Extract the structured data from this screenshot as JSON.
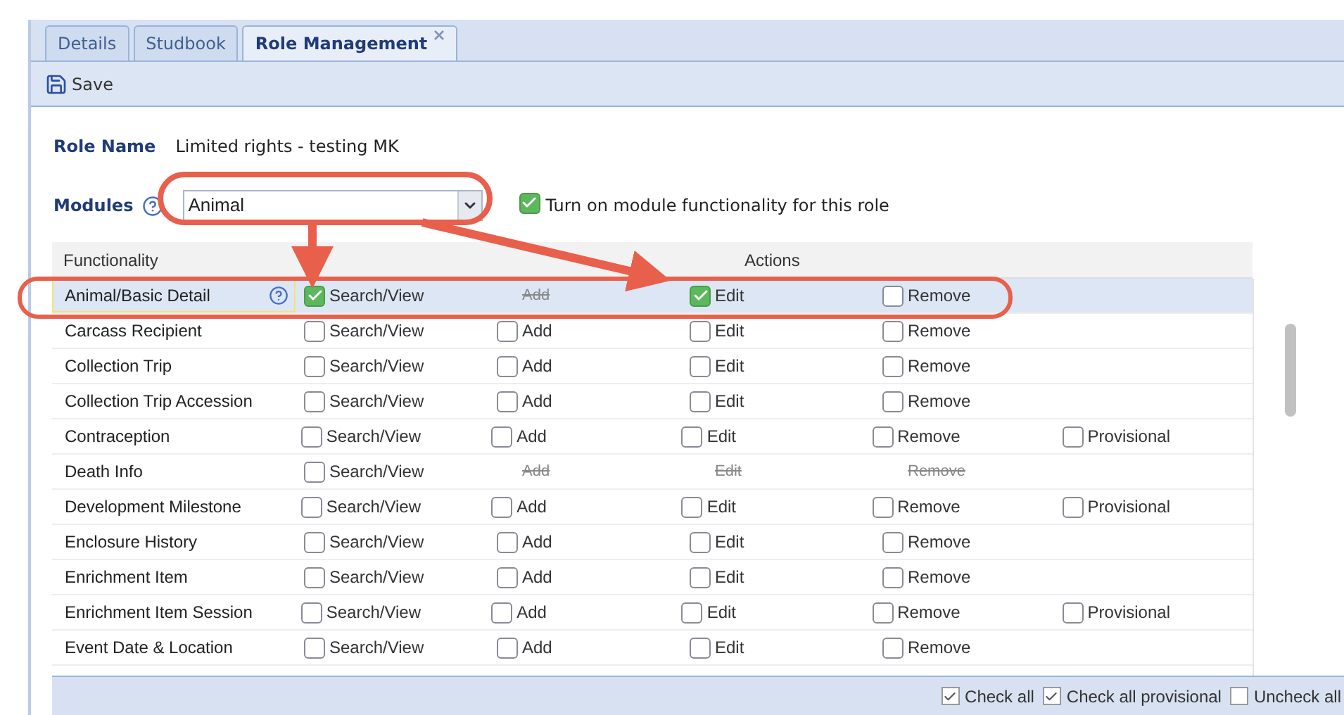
{
  "tabs": [
    {
      "label": "Details",
      "selected": false,
      "closable": false
    },
    {
      "label": "Studbook",
      "selected": false,
      "closable": false
    },
    {
      "label": "Role Management",
      "selected": true,
      "closable": true
    }
  ],
  "toolbar": {
    "save_label": "Save"
  },
  "form": {
    "role_name_label": "Role Name",
    "role_name": "Limited rights - testing MK",
    "modules_label": "Modules",
    "module": "Animal",
    "module_enabled": true,
    "module_enabled_label": "Turn on module functionality for this role"
  },
  "table": {
    "columns": [
      "Functionality",
      "Actions"
    ],
    "rows": [
      {
        "name": "Animal/Basic Detail",
        "selected": true,
        "help": true,
        "cells": [
          {
            "kind": "checkbox",
            "label": "Search/View",
            "checked": true
          },
          {
            "kind": "unavailable",
            "label": "Add"
          },
          {
            "kind": "checkbox",
            "label": "Edit",
            "checked": true
          },
          {
            "kind": "checkbox",
            "label": "Remove",
            "checked": false
          }
        ]
      },
      {
        "name": "Carcass Recipient",
        "selected": false,
        "help": false,
        "cells": [
          {
            "kind": "checkbox",
            "label": "Search/View",
            "checked": false
          },
          {
            "kind": "checkbox",
            "label": "Add",
            "checked": false
          },
          {
            "kind": "checkbox",
            "label": "Edit",
            "checked": false
          },
          {
            "kind": "checkbox",
            "label": "Remove",
            "checked": false
          }
        ]
      },
      {
        "name": "Collection Trip",
        "selected": false,
        "help": false,
        "cells": [
          {
            "kind": "checkbox",
            "label": "Search/View",
            "checked": false
          },
          {
            "kind": "checkbox",
            "label": "Add",
            "checked": false
          },
          {
            "kind": "checkbox",
            "label": "Edit",
            "checked": false
          },
          {
            "kind": "checkbox",
            "label": "Remove",
            "checked": false
          }
        ]
      },
      {
        "name": "Collection Trip Accession",
        "selected": false,
        "help": false,
        "cells": [
          {
            "kind": "checkbox",
            "label": "Search/View",
            "checked": false
          },
          {
            "kind": "checkbox",
            "label": "Add",
            "checked": false
          },
          {
            "kind": "checkbox",
            "label": "Edit",
            "checked": false
          },
          {
            "kind": "checkbox",
            "label": "Remove",
            "checked": false
          }
        ]
      },
      {
        "name": "Contraception",
        "selected": false,
        "help": false,
        "cells": [
          {
            "kind": "checkbox",
            "label": "Search/View",
            "checked": false
          },
          {
            "kind": "checkbox",
            "label": "Add",
            "checked": false
          },
          {
            "kind": "checkbox",
            "label": "Edit",
            "checked": false
          },
          {
            "kind": "checkbox",
            "label": "Remove",
            "checked": false
          },
          {
            "kind": "checkbox",
            "label": "Provisional",
            "checked": false
          }
        ]
      },
      {
        "name": "Death Info",
        "selected": false,
        "help": false,
        "cells": [
          {
            "kind": "checkbox",
            "label": "Search/View",
            "checked": false
          },
          {
            "kind": "unavailable",
            "label": "Add"
          },
          {
            "kind": "unavailable",
            "label": "Edit"
          },
          {
            "kind": "unavailable",
            "label": "Remove"
          }
        ]
      },
      {
        "name": "Development Milestone",
        "selected": false,
        "help": false,
        "cells": [
          {
            "kind": "checkbox",
            "label": "Search/View",
            "checked": false
          },
          {
            "kind": "checkbox",
            "label": "Add",
            "checked": false
          },
          {
            "kind": "checkbox",
            "label": "Edit",
            "checked": false
          },
          {
            "kind": "checkbox",
            "label": "Remove",
            "checked": false
          },
          {
            "kind": "checkbox",
            "label": "Provisional",
            "checked": false
          }
        ]
      },
      {
        "name": "Enclosure History",
        "selected": false,
        "help": false,
        "cells": [
          {
            "kind": "checkbox",
            "label": "Search/View",
            "checked": false
          },
          {
            "kind": "checkbox",
            "label": "Add",
            "checked": false
          },
          {
            "kind": "checkbox",
            "label": "Edit",
            "checked": false
          },
          {
            "kind": "checkbox",
            "label": "Remove",
            "checked": false
          }
        ]
      },
      {
        "name": "Enrichment Item",
        "selected": false,
        "help": false,
        "cells": [
          {
            "kind": "checkbox",
            "label": "Search/View",
            "checked": false
          },
          {
            "kind": "checkbox",
            "label": "Add",
            "checked": false
          },
          {
            "kind": "checkbox",
            "label": "Edit",
            "checked": false
          },
          {
            "kind": "checkbox",
            "label": "Remove",
            "checked": false
          }
        ]
      },
      {
        "name": "Enrichment Item Session",
        "selected": false,
        "help": false,
        "cells": [
          {
            "kind": "checkbox",
            "label": "Search/View",
            "checked": false
          },
          {
            "kind": "checkbox",
            "label": "Add",
            "checked": false
          },
          {
            "kind": "checkbox",
            "label": "Edit",
            "checked": false
          },
          {
            "kind": "checkbox",
            "label": "Remove",
            "checked": false
          },
          {
            "kind": "checkbox",
            "label": "Provisional",
            "checked": false
          }
        ]
      },
      {
        "name": "Event Date & Location",
        "selected": false,
        "help": false,
        "cells": [
          {
            "kind": "checkbox",
            "label": "Search/View",
            "checked": false
          },
          {
            "kind": "checkbox",
            "label": "Add",
            "checked": false
          },
          {
            "kind": "checkbox",
            "label": "Edit",
            "checked": false
          },
          {
            "kind": "checkbox",
            "label": "Remove",
            "checked": false
          }
        ]
      }
    ]
  },
  "footer": [
    {
      "label": "Check all",
      "checked": true
    },
    {
      "label": "Check all provisional",
      "checked": true
    },
    {
      "label": "Uncheck all",
      "checked": false
    }
  ]
}
